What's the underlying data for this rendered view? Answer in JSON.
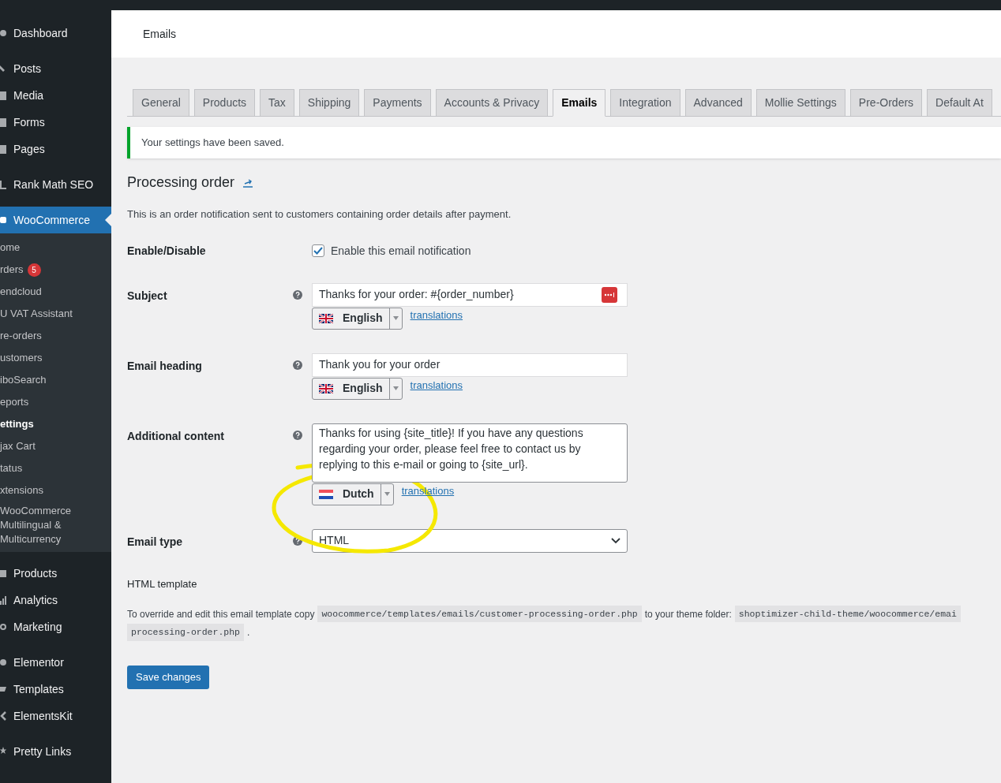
{
  "sidebar": {
    "items_top": [
      {
        "label": "Dashboard"
      },
      {
        "label": "Posts"
      },
      {
        "label": "Media"
      },
      {
        "label": "Forms"
      },
      {
        "label": "Pages"
      },
      {
        "label": "Rank Math SEO"
      }
    ],
    "active": {
      "label": "WooCommerce"
    },
    "submenu": [
      {
        "label": "ome",
        "selected": false
      },
      {
        "label": "rders",
        "selected": false,
        "badge": "5"
      },
      {
        "label": "endcloud",
        "selected": false
      },
      {
        "label": "U VAT Assistant",
        "selected": false
      },
      {
        "label": "re-orders",
        "selected": false
      },
      {
        "label": "ustomers",
        "selected": false
      },
      {
        "label": "iboSearch",
        "selected": false
      },
      {
        "label": "eports",
        "selected": false
      },
      {
        "label": "ettings",
        "selected": true
      },
      {
        "label": "jax Cart",
        "selected": false
      },
      {
        "label": "tatus",
        "selected": false
      },
      {
        "label": "xtensions",
        "selected": false
      },
      {
        "label": "WooCommerce Multilingual & Multicurrency",
        "selected": false
      }
    ],
    "items_bottom": [
      {
        "label": "Products"
      },
      {
        "label": "Analytics"
      },
      {
        "label": "Marketing"
      },
      {
        "label": "Elementor"
      },
      {
        "label": "Templates"
      },
      {
        "label": "ElementsKit"
      },
      {
        "label": "Pretty Links"
      }
    ]
  },
  "header": {
    "title": "Emails"
  },
  "tabs": [
    {
      "label": "General",
      "selected": false
    },
    {
      "label": "Products",
      "selected": false
    },
    {
      "label": "Tax",
      "selected": false
    },
    {
      "label": "Shipping",
      "selected": false
    },
    {
      "label": "Payments",
      "selected": false
    },
    {
      "label": "Accounts & Privacy",
      "selected": false
    },
    {
      "label": "Emails",
      "selected": true
    },
    {
      "label": "Integration",
      "selected": false
    },
    {
      "label": "Advanced",
      "selected": false
    },
    {
      "label": "Mollie Settings",
      "selected": false
    },
    {
      "label": "Pre-Orders",
      "selected": false
    },
    {
      "label": "Default At",
      "selected": false
    }
  ],
  "notice": "Your settings have been saved.",
  "section": {
    "title": "Processing order",
    "description": "This is an order notification sent to customers containing order details after payment."
  },
  "fields": [
    {
      "kind": "checkbox",
      "label": "Enable/Disable",
      "checked": true,
      "text": "Enable this email notification"
    },
    {
      "kind": "text",
      "label": "Subject",
      "value": "Thanks for your order: #{order_number}",
      "language": "English",
      "link": "translations"
    },
    {
      "kind": "text",
      "label": "Email heading",
      "value": "Thank you for your order",
      "language": "English",
      "link": "translations"
    },
    {
      "kind": "textarea",
      "label": "Additional content",
      "value": "Thanks for using {site_title}! If you have any questions regarding your order, please feel free to contact us by replying to this e-mail or going to {site_url}.",
      "language": "Dutch",
      "link": "translations"
    },
    {
      "kind": "select",
      "label": "Email type",
      "value": "HTML"
    }
  ],
  "template": {
    "title": "HTML template",
    "line1": [
      {
        "kind": "text",
        "text": "To override and edit this email template copy"
      },
      {
        "kind": "code",
        "text": "woocommerce/templates/emails/customer-processing-order.php"
      },
      {
        "kind": "text",
        "text": "to your theme folder:"
      },
      {
        "kind": "code",
        "text": "shoptimizer-child-theme/woocommerce/emai"
      }
    ],
    "line2": [
      {
        "kind": "code",
        "text": "processing-order.php"
      },
      {
        "kind": "text",
        "text": "."
      }
    ]
  },
  "save_button": "Save changes"
}
